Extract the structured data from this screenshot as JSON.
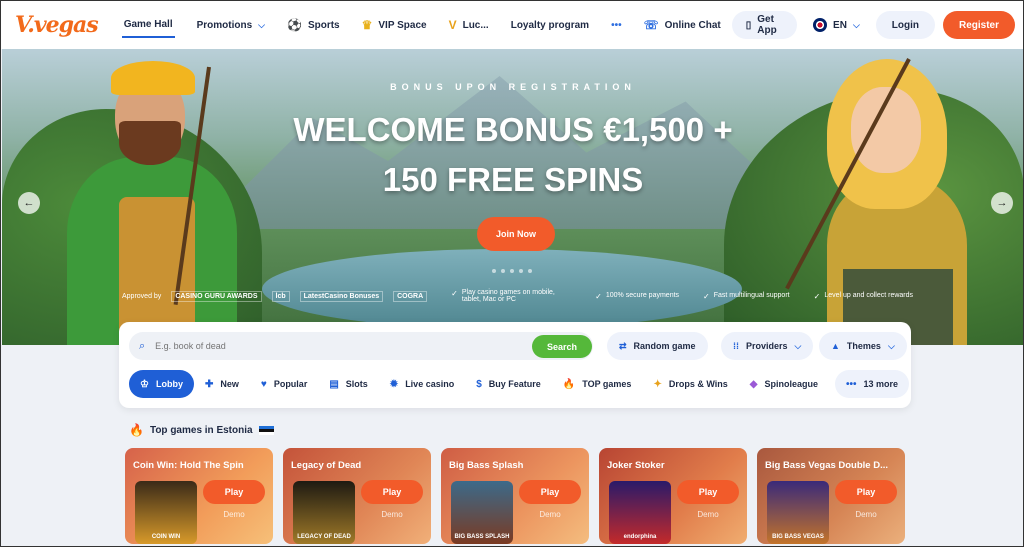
{
  "header": {
    "logo": "V.vegas",
    "nav": [
      {
        "label": "Game Hall",
        "icon": "",
        "chevron": false,
        "active": true
      },
      {
        "label": "Promotions",
        "icon": "",
        "chevron": true
      },
      {
        "label": "Sports",
        "icon": "⚽"
      },
      {
        "label": "VIP Space",
        "icon": "♛"
      },
      {
        "label": "Luc...",
        "icon": "V"
      },
      {
        "label": "Loyalty program",
        "icon": ""
      },
      {
        "label": "•••",
        "icon": ""
      },
      {
        "label": "Online Chat",
        "icon": "☏"
      }
    ],
    "get_app": "Get App",
    "lang": "EN",
    "login": "Login",
    "register": "Register"
  },
  "hero": {
    "subtitle": "BONUS UPON REGISTRATION",
    "title_line1": "WELCOME BONUS €1,500 +",
    "title_line2": "150 FREE SPINS",
    "cta": "Join Now",
    "approved_by": "Approved by",
    "partners": [
      "CASINO GURU AWARDS",
      "lcb",
      "LatestCasino Bonuses",
      "COGRA"
    ],
    "features": [
      "Play casino games on mobile, tablet, Mac or PC",
      "100% secure payments",
      "Fast multilingual support",
      "Level up and collect rewards"
    ]
  },
  "search": {
    "placeholder": "E.g. book of dead",
    "button": "Search",
    "random": "Random game",
    "providers": "Providers",
    "themes": "Themes"
  },
  "categories": [
    {
      "label": "Lobby",
      "icon": "♔",
      "active": true
    },
    {
      "label": "New",
      "icon": "✚"
    },
    {
      "label": "Popular",
      "icon": "♥"
    },
    {
      "label": "Slots",
      "icon": "▤"
    },
    {
      "label": "Live casino",
      "icon": "✹"
    },
    {
      "label": "Buy Feature",
      "icon": "$"
    },
    {
      "label": "TOP games",
      "icon": "🔥"
    },
    {
      "label": "Drops & Wins",
      "icon": "✦"
    },
    {
      "label": "Spinoleague",
      "icon": "◆"
    },
    {
      "label": "13 more",
      "icon": "•••"
    }
  ],
  "top_games": {
    "title": "Top games in Estonia",
    "games": [
      {
        "name": "Coin Win: Hold The Spin",
        "thumb": "COIN WIN",
        "play": "Play",
        "demo": "Demo"
      },
      {
        "name": "Legacy of Dead",
        "thumb": "LEGACY OF DEAD",
        "play": "Play",
        "demo": "Demo"
      },
      {
        "name": "Big Bass Splash",
        "thumb": "BIG BASS SPLASH",
        "play": "Play",
        "demo": "Demo"
      },
      {
        "name": "Joker Stoker",
        "thumb": "endorphina",
        "play": "Play",
        "demo": "Demo"
      },
      {
        "name": "Big Bass Vegas Double D...",
        "thumb": "BIG BASS VEGAS",
        "play": "Play",
        "demo": "Demo"
      }
    ]
  }
}
